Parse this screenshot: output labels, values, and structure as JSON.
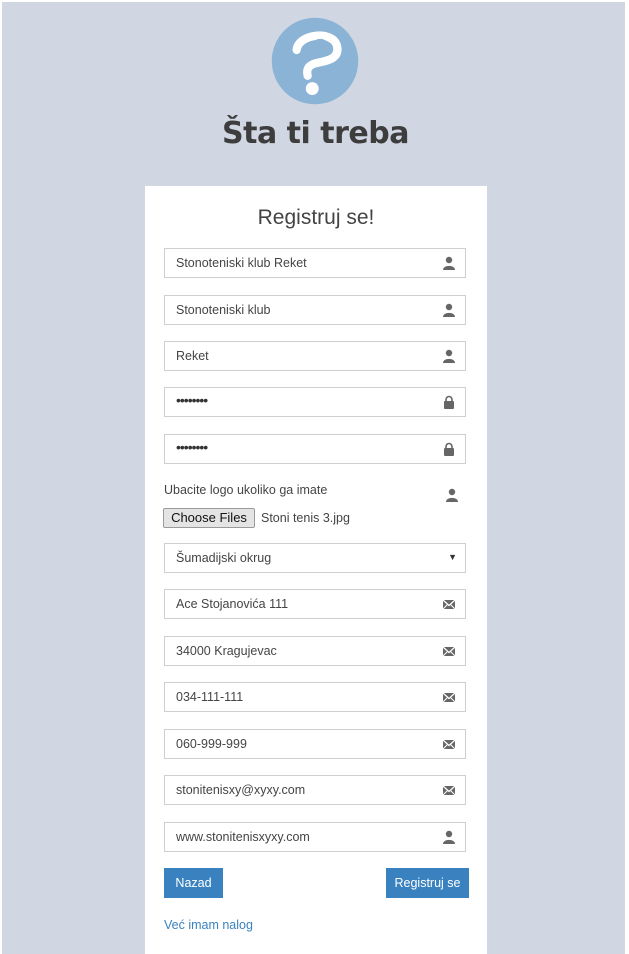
{
  "brand": {
    "logo_icon": "question-mark-logo-icon",
    "title": "Šta ti treba"
  },
  "form": {
    "title": "Registruj se!",
    "fields": [
      {
        "value": "Stonoteniski klub Reket",
        "icon": "user-icon"
      },
      {
        "value": "Stonoteniski klub",
        "icon": "user-icon"
      },
      {
        "value": "Reket",
        "icon": "user-icon"
      },
      {
        "value": "••••••••",
        "icon": "lock-icon"
      },
      {
        "value": "••••••••",
        "icon": "lock-icon"
      },
      {
        "value": "Ace Stojanovića 111",
        "icon": "envelope-icon"
      },
      {
        "value": "34000 Kragujevac",
        "icon": "envelope-icon"
      },
      {
        "value": "034-111-111",
        "icon": "envelope-icon"
      },
      {
        "value": "060-999-999",
        "icon": "envelope-icon"
      },
      {
        "value": "stonitenisxy@xyxy.com",
        "icon": "envelope-icon"
      },
      {
        "value": "www.stonitenisxyxy.com",
        "icon": "user-icon"
      }
    ],
    "upload": {
      "label": "Ubacite logo ukoliko ga imate",
      "button": "Choose Files",
      "file_name": "Stoni tenis 3.jpg"
    },
    "district_select": {
      "selected": "Šumadijski okrug"
    },
    "back_button": "Nazad",
    "submit_button": "Registruj se",
    "login_link": "Već imam nalog"
  },
  "colors": {
    "background": "#d0d7e2",
    "accent": "#3a82bf",
    "logo": "#8ab3d6"
  }
}
